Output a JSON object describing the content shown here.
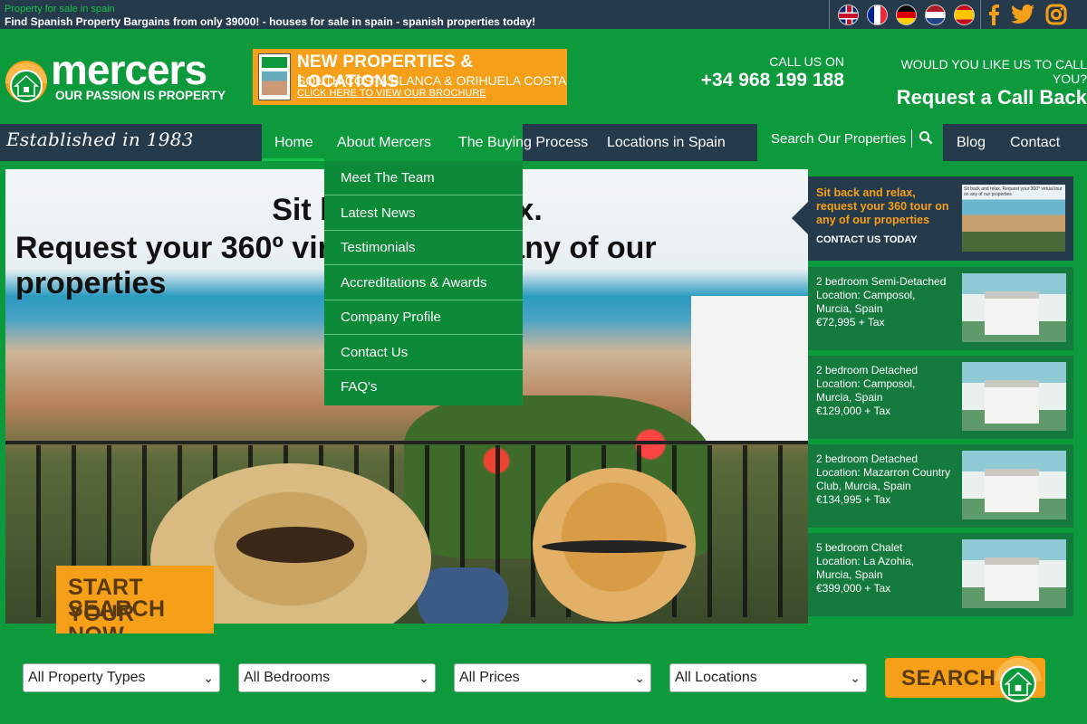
{
  "topbar": {
    "tagline": "Property for sale in spain",
    "headline": "Find Spanish Property Bargains from only 39000! - houses for sale in spain - spanish properties today!",
    "flags": [
      "uk-flag-icon",
      "france-flag-icon",
      "germany-flag-icon",
      "netherlands-flag-icon",
      "spain-flag-icon"
    ],
    "social": [
      "facebook-icon",
      "twitter-icon",
      "instagram-icon"
    ]
  },
  "header": {
    "logo_word": "mercers",
    "logo_sub": "OUR PASSION IS PROPERTY",
    "brochure": {
      "title": "NEW PROPERTIES & LOCATIONS",
      "subtitle": "SOUTH COSTA BLANCA & ORIHUELA COSTA",
      "link": "CLICK HERE TO VIEW OUR BROCHURE"
    },
    "call_label": "CALL US ON",
    "phone": "+34 968 199 188",
    "callback_label": "WOULD YOU LIKE US TO CALL YOU?",
    "callback_action": "Request a Call Back"
  },
  "nav": {
    "established": "Established in 1983",
    "items": [
      "Home",
      "About Mercers",
      "The Buying Process",
      "Locations in Spain"
    ],
    "search_label": "Search Our Properties",
    "right_items": [
      "Blog",
      "Contact Us"
    ]
  },
  "dropdown": {
    "items": [
      "Meet The Team",
      "Latest News",
      "Testimonials",
      "Accreditations & Awards",
      "Company Profile",
      "Contact Us",
      "FAQ's"
    ]
  },
  "hero": {
    "line1": "Sit back and relax.",
    "line2": "Request your 360º virtual tour on any of our properties",
    "badge_line1": "START YOUR",
    "badge_line2": "SEARCH NOW"
  },
  "promo": {
    "text": "Sit back and relax, request your 360 tour on any of our properties",
    "cta": "CONTACT US TODAY",
    "image_caption": "Sit back and relax. Request your 360° virtual tour on any of our properties"
  },
  "properties": [
    {
      "title": "2 bedroom Semi-Detached",
      "location": "Location: Camposol, Murcia, Spain",
      "price": "€72,995 + Tax"
    },
    {
      "title": "2 bedroom Detached",
      "location": "Location: Camposol, Murcia, Spain",
      "price": "€129,000 + Tax"
    },
    {
      "title": "2 bedroom Detached",
      "location": "Location: Mazarron Country Club, Murcia, Spain",
      "price": "€134,995 + Tax"
    },
    {
      "title": "5 bedroom Chalet",
      "location": "Location: La Azohia, Murcia, Spain",
      "price": "€399,000 + Tax"
    }
  ],
  "search": {
    "property_types": "All Property Types",
    "bedrooms": "All Bedrooms",
    "prices": "All Prices",
    "locations": "All Locations",
    "button": "SEARCH"
  },
  "colors": {
    "green": "#0c9a3c",
    "dark": "#253a4a",
    "orange": "#f6a01a"
  }
}
